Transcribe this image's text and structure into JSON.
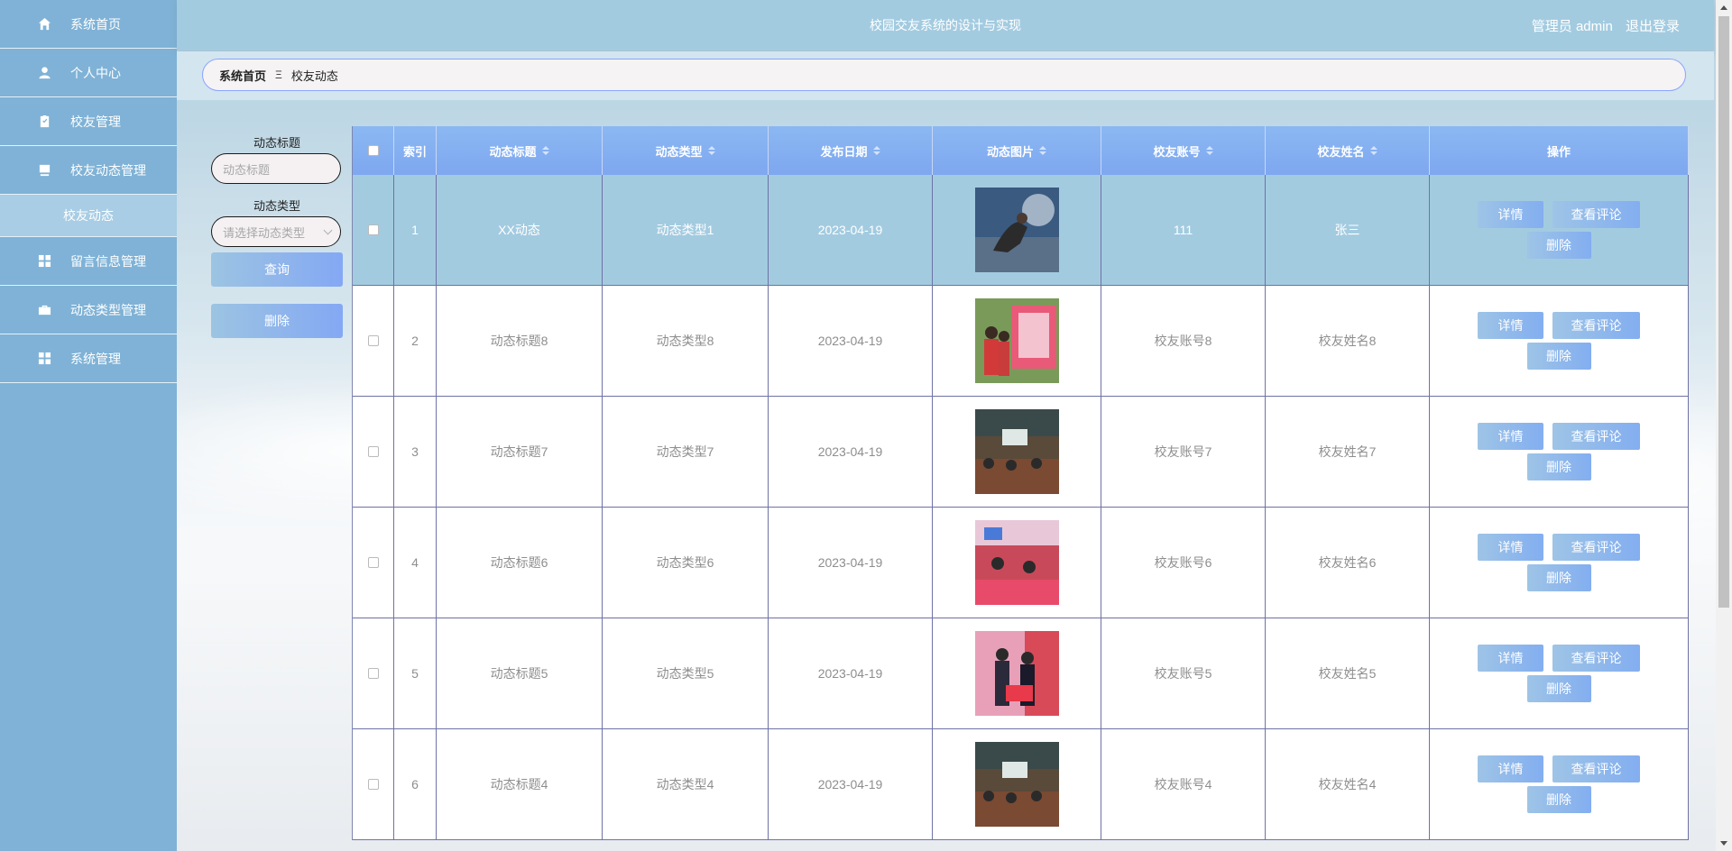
{
  "app": {
    "title": "校园交友系统的设计与实现",
    "user_label": "管理员 admin",
    "logout": "退出登录"
  },
  "sidebar": {
    "items": [
      {
        "label": "系统首页",
        "icon": "home-icon"
      },
      {
        "label": "个人中心",
        "icon": "user-icon"
      },
      {
        "label": "校友管理",
        "icon": "clipboard-icon"
      },
      {
        "label": "校友动态管理",
        "icon": "tray-icon"
      },
      {
        "label": "留言信息管理",
        "icon": "grid-icon"
      },
      {
        "label": "动态类型管理",
        "icon": "briefcase-icon"
      },
      {
        "label": "系统管理",
        "icon": "grid-icon"
      }
    ],
    "subitem": {
      "label": "校友动态"
    }
  },
  "breadcrumb": {
    "home": "系统首页",
    "separator": "Ξ",
    "current": "校友动态"
  },
  "search": {
    "title_label": "动态标题",
    "title_placeholder": "动态标题",
    "type_label": "动态类型",
    "type_placeholder": "请选择动态类型",
    "query_button": "查询",
    "delete_button": "删除"
  },
  "table": {
    "headers": {
      "index": "索引",
      "title": "动态标题",
      "type": "动态类型",
      "date": "发布日期",
      "image": "动态图片",
      "account": "校友账号",
      "name": "校友姓名",
      "ops": "操作"
    },
    "action_labels": {
      "detail": "详情",
      "comments": "查看评论",
      "delete": "删除"
    },
    "rows": [
      {
        "index": "1",
        "title": "XX动态",
        "type": "动态类型1",
        "date": "2023-04-19",
        "account": "111",
        "name": "张三"
      },
      {
        "index": "2",
        "title": "动态标题8",
        "type": "动态类型8",
        "date": "2023-04-19",
        "account": "校友账号8",
        "name": "校友姓名8"
      },
      {
        "index": "3",
        "title": "动态标题7",
        "type": "动态类型7",
        "date": "2023-04-19",
        "account": "校友账号7",
        "name": "校友姓名7"
      },
      {
        "index": "4",
        "title": "动态标题6",
        "type": "动态类型6",
        "date": "2023-04-19",
        "account": "校友账号6",
        "name": "校友姓名6"
      },
      {
        "index": "5",
        "title": "动态标题5",
        "type": "动态类型5",
        "date": "2023-04-19",
        "account": "校友账号5",
        "name": "校友姓名5"
      },
      {
        "index": "6",
        "title": "动态标题4",
        "type": "动态类型4",
        "date": "2023-04-19",
        "account": "校友账号4",
        "name": "校友姓名4"
      }
    ]
  }
}
